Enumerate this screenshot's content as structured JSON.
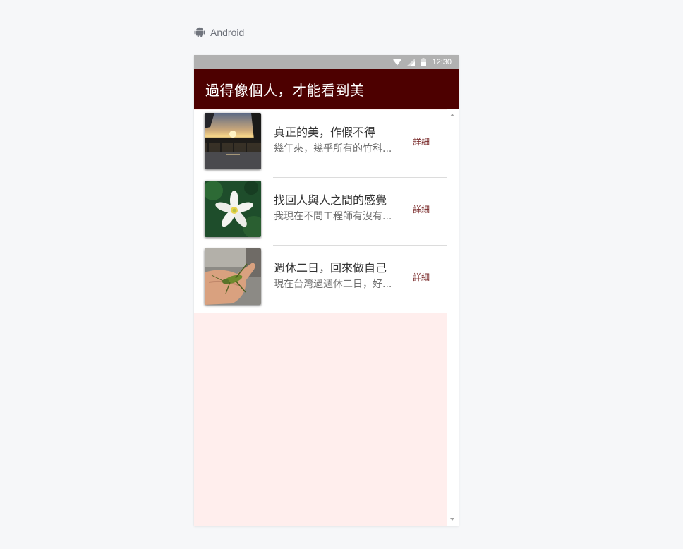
{
  "platform": {
    "label": "Android",
    "icon": "android-icon"
  },
  "statusbar": {
    "time": "12:30",
    "icons": [
      "wifi-icon",
      "signal-icon",
      "battery-icon"
    ]
  },
  "appbar": {
    "title": "過得像個人，才能看到美",
    "background": "#4d0000"
  },
  "list": {
    "items": [
      {
        "title": "真正的美，作假不得",
        "summary": "幾年來，幾乎所有的竹科...",
        "action": "詳細",
        "thumbnail": "sunset-bridge-photo"
      },
      {
        "title": "找回人與人之間的感覺",
        "summary": "我現在不問工程師有沒有...",
        "action": "詳細",
        "thumbnail": "white-lotus-photo"
      },
      {
        "title": "週休二日，回來做自己",
        "summary": "現在台灣過週休二日，好...",
        "action": "詳細",
        "thumbnail": "grasshopper-hand-photo"
      }
    ]
  },
  "colors": {
    "accent": "#4d0000",
    "detail_text": "#7a2b2b",
    "page_bg": "#ffeeed"
  }
}
